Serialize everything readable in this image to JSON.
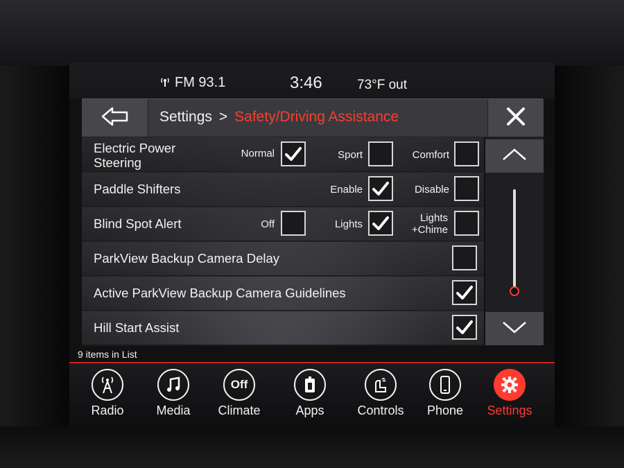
{
  "status": {
    "radio": "FM 93.1",
    "time": "3:46",
    "temperature": "73°F out"
  },
  "header": {
    "section": "Settings",
    "separator": ">",
    "current": "Safety/Driving Assistance"
  },
  "rows": [
    {
      "label": "Electric Power Steering",
      "options": [
        {
          "label": "Normal",
          "checked": true
        },
        {
          "label": "Sport",
          "checked": false
        },
        {
          "label": "Comfort",
          "checked": false
        }
      ]
    },
    {
      "label": "Paddle Shifters",
      "options": [
        {
          "label": "Enable",
          "checked": true
        },
        {
          "label": "Disable",
          "checked": false
        }
      ]
    },
    {
      "label": "Blind Spot Alert",
      "options": [
        {
          "label": "Off",
          "checked": false
        },
        {
          "label": "Lights",
          "checked": true
        },
        {
          "label": "Lights +Chime",
          "checked": false
        }
      ]
    },
    {
      "label": "ParkView Backup Camera Delay",
      "checked": false
    },
    {
      "label": "Active ParkView Backup Camera Guidelines",
      "checked": true
    },
    {
      "label": "Hill Start Assist",
      "checked": true
    }
  ],
  "list_count": "9 items in List",
  "nav": [
    {
      "label": "Radio",
      "icon": "radio-tower-icon"
    },
    {
      "label": "Media",
      "icon": "music-note-icon"
    },
    {
      "label": "Climate",
      "icon": "climate-off-icon",
      "glyph": "Off"
    },
    {
      "label": "Apps",
      "icon": "apps-icon"
    },
    {
      "label": "Controls",
      "icon": "controls-icon"
    },
    {
      "label": "Phone",
      "icon": "phone-icon"
    },
    {
      "label": "Settings",
      "icon": "gear-icon",
      "active": true
    }
  ],
  "colors": {
    "accent": "#ff3b30",
    "panel": "#3a3a3e"
  }
}
